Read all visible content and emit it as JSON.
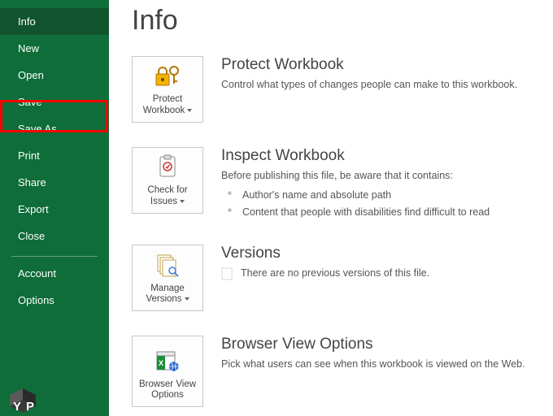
{
  "sidebar": {
    "items": [
      {
        "label": "Info",
        "selected": true
      },
      {
        "label": "New"
      },
      {
        "label": "Open"
      },
      {
        "label": "Save",
        "highlighted": true
      },
      {
        "label": "Save As"
      },
      {
        "label": "Print"
      },
      {
        "label": "Share"
      },
      {
        "label": "Export"
      },
      {
        "label": "Close"
      }
    ],
    "footer": [
      {
        "label": "Account"
      },
      {
        "label": "Options"
      }
    ]
  },
  "page": {
    "title": "Info"
  },
  "protect": {
    "button_label": "Protect Workbook",
    "title": "Protect Workbook",
    "desc": "Control what types of changes people can make to this workbook."
  },
  "inspect": {
    "button_label": "Check for Issues",
    "title": "Inspect Workbook",
    "desc": "Before publishing this file, be aware that it contains:",
    "bullets": [
      "Author's name and absolute path",
      "Content that people with disabilities find difficult to read"
    ]
  },
  "versions": {
    "button_label": "Manage Versions",
    "title": "Versions",
    "desc": "There are no previous versions of this file."
  },
  "browser": {
    "button_label": "Browser View Options",
    "title": "Browser View Options",
    "desc": "Pick what users can see when this workbook is viewed on the Web."
  }
}
